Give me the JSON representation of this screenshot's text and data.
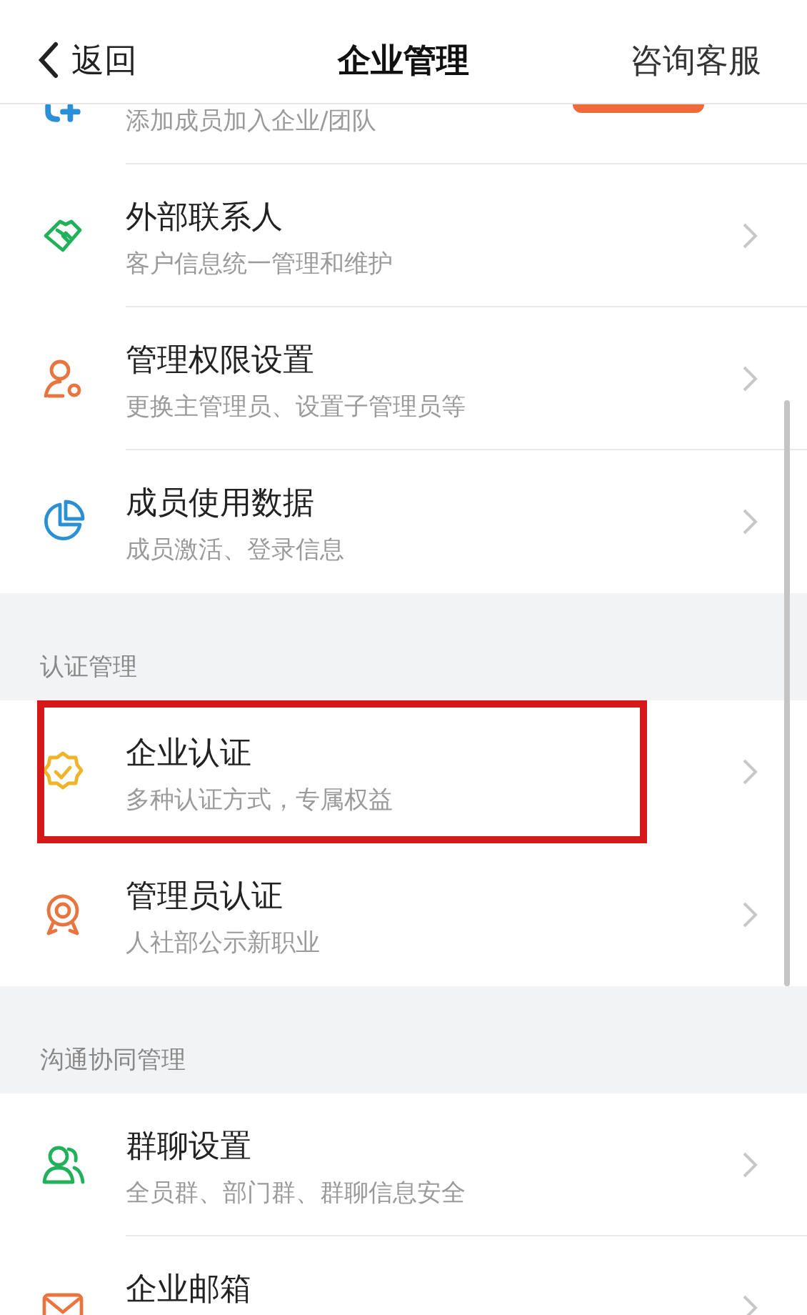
{
  "nav": {
    "back": "返回",
    "title": "企业管理",
    "action": "咨询客服"
  },
  "sections": [
    {
      "items": [
        {
          "kind": "partial",
          "color": "#2b8fd6",
          "subtitle": "添加成员加入企业/团队",
          "highlighted": false
        },
        {
          "kind": "row",
          "color": "#21b15a",
          "title": "外部联系人",
          "subtitle": "客户信息统一管理和维护",
          "highlighted": false
        },
        {
          "kind": "row",
          "color": "#e8743f",
          "title": "管理权限设置",
          "subtitle": "更换主管理员、设置子管理员等",
          "highlighted": false
        },
        {
          "kind": "row",
          "color": "#2b8fd6",
          "title": "成员使用数据",
          "subtitle": "成员激活、登录信息",
          "highlighted": false
        }
      ]
    },
    {
      "header": "认证管理",
      "items": [
        {
          "kind": "row",
          "color": "#f0b429",
          "title": "企业认证",
          "subtitle": "多种认证方式，专属权益",
          "highlighted": true
        },
        {
          "kind": "row",
          "color": "#e8743f",
          "title": "管理员认证",
          "subtitle": "人社部公示新职业",
          "highlighted": false
        }
      ]
    },
    {
      "header": "沟通协同管理",
      "items": [
        {
          "kind": "row",
          "color": "#21b15a",
          "title": "群聊设置",
          "subtitle": "全员群、部门群、群聊信息安全",
          "highlighted": false
        },
        {
          "kind": "row",
          "color": "#e8743f",
          "title": "企业邮箱",
          "highlighted": false
        }
      ]
    }
  ]
}
